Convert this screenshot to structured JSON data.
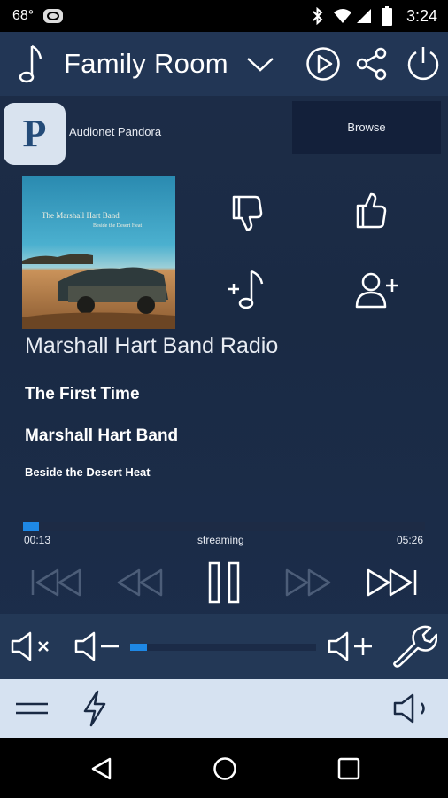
{
  "status_bar": {
    "temperature": "68°",
    "time": "3:24"
  },
  "header": {
    "room": "Family Room"
  },
  "source": {
    "logo_letter": "P",
    "name": "Audionet Pandora",
    "browse_label": "Browse"
  },
  "album_art": {
    "band_text": "The Marshall Hart Band",
    "album_text": "Beside the Desert Heat"
  },
  "now_playing": {
    "station": "Marshall Hart Band Radio",
    "title": "The First Time",
    "artist": "Marshall Hart Band",
    "album": "Beside the Desert Heat"
  },
  "progress": {
    "elapsed": "00:13",
    "status": "streaming",
    "total": "05:26",
    "fraction": 0.04
  },
  "volume": {
    "level": 0.09
  },
  "colors": {
    "accent": "#1e88e5",
    "header": "#223655",
    "background": "#1a2a44",
    "toolbar": "#d6e2f1"
  }
}
